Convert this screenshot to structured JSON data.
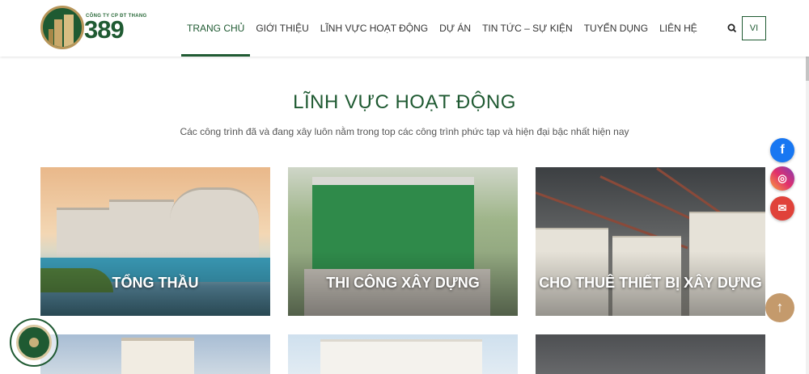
{
  "brand": {
    "tagline": "CÔNG TY CP ĐT THANG",
    "number": "389"
  },
  "nav": {
    "items": [
      {
        "label": "TRANG CHỦ",
        "active": true
      },
      {
        "label": "GIỚI THIỆU"
      },
      {
        "label": "LĨNH VỰC HOẠT ĐỘNG"
      },
      {
        "label": "DỰ ÁN"
      },
      {
        "label": "TIN TỨC – SỰ KIỆN"
      },
      {
        "label": "TUYỂN DỤNG"
      },
      {
        "label": "LIÊN HỆ"
      }
    ],
    "search_icon": "search-icon",
    "lang_label": "VI"
  },
  "section": {
    "title": "LĨNH VỰC HOẠT ĐỘNG",
    "subtitle": "Các công trình đã và đang xây luôn nằm trong top các công trình phức tạp và hiện đại bậc nhất hiện nay"
  },
  "cards": [
    {
      "label": "TỔNG THẦU"
    },
    {
      "label": "THI CÔNG XÂY DỰNG"
    },
    {
      "label": "CHO THUÊ THIẾT BỊ XÂY DỰNG"
    }
  ],
  "floating": {
    "facebook_glyph": "f",
    "instagram_glyph": "◎",
    "mail_glyph": "✉",
    "top_glyph": "↑"
  },
  "colors": {
    "brand_green": "#1f5a32",
    "accent_gold": "#c49a6c"
  }
}
